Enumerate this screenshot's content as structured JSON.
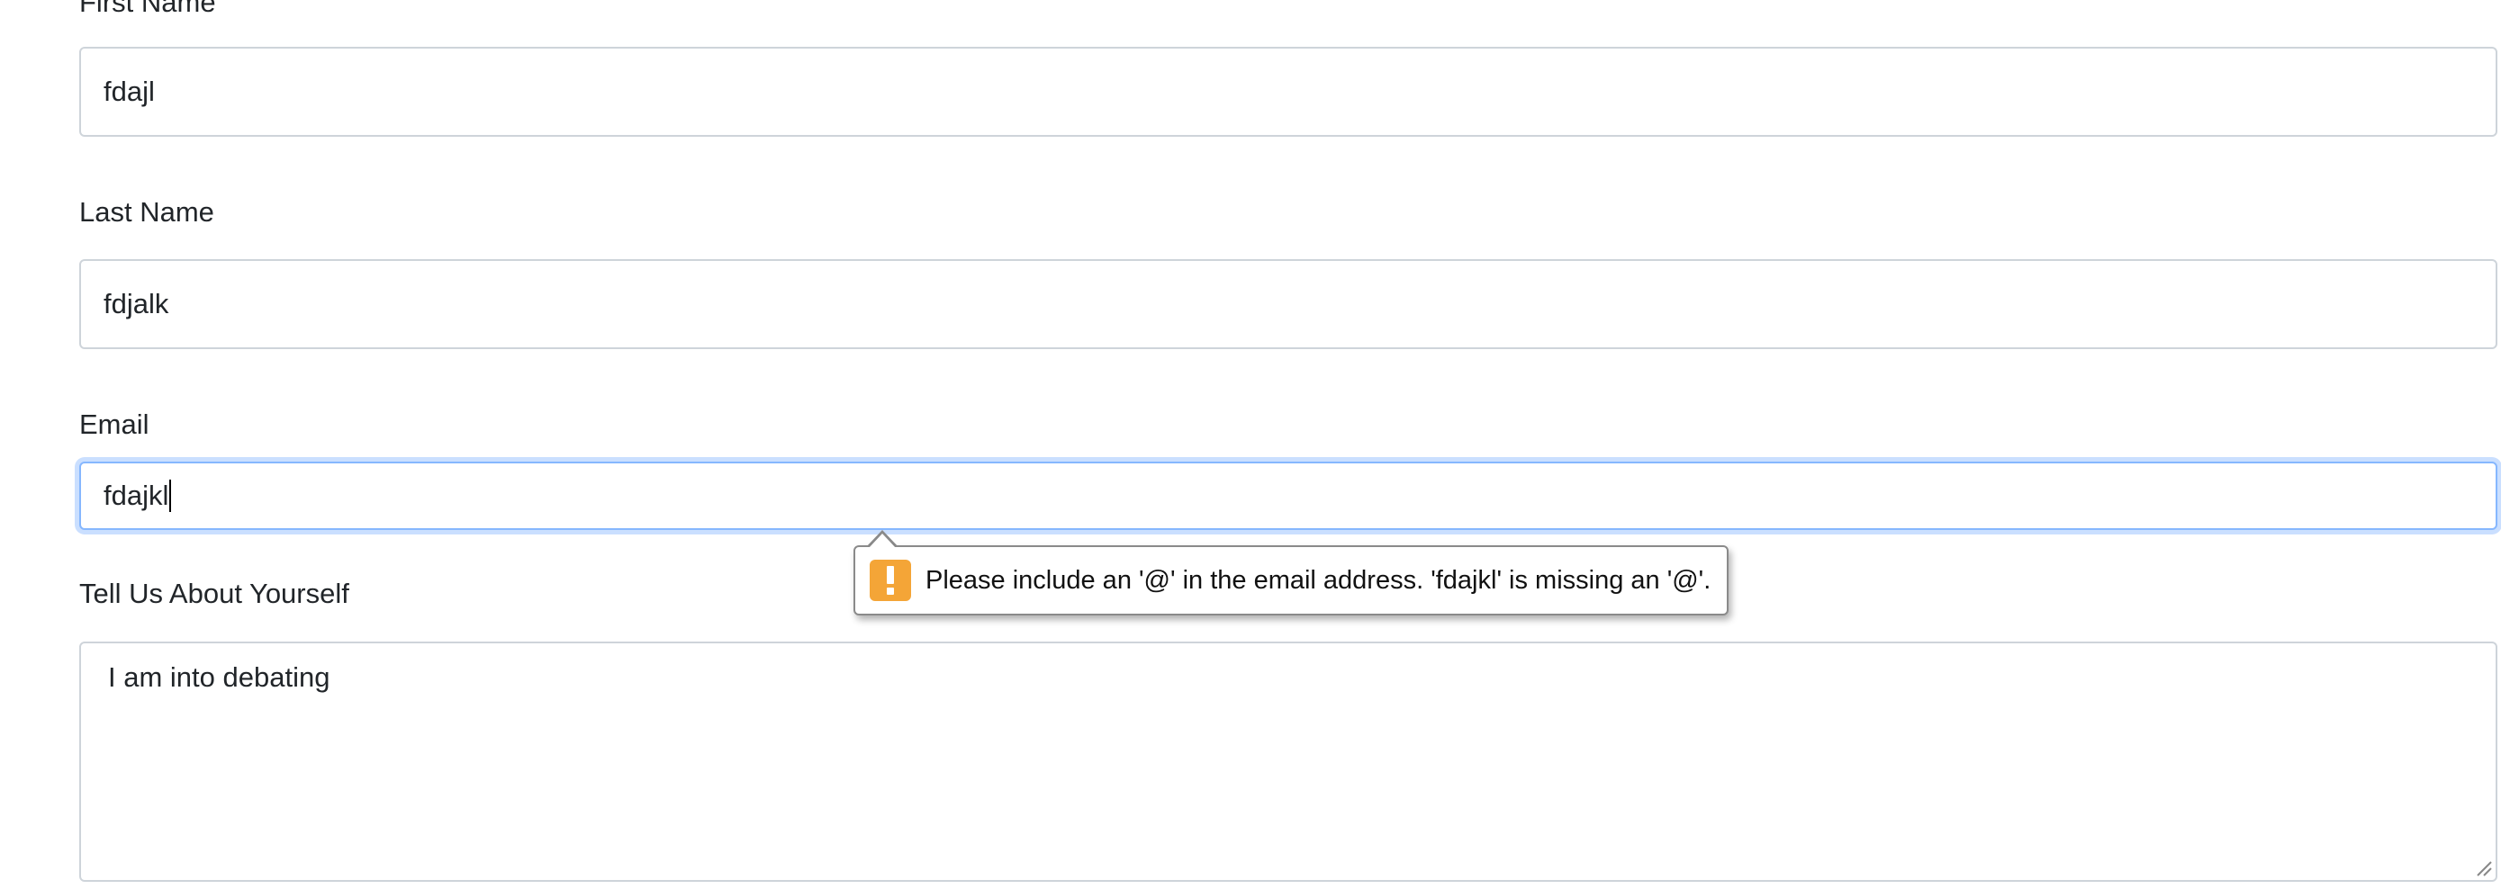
{
  "form": {
    "first_name": {
      "label": "First Name",
      "value": "fdajl"
    },
    "last_name": {
      "label": "Last Name",
      "value": "fdjalk"
    },
    "email": {
      "label": "Email",
      "value": "fdajkl"
    },
    "about": {
      "label": "Tell Us About Yourself",
      "value": "I am into debating"
    }
  },
  "validation_tooltip": {
    "icon": "warning-icon",
    "message": "Please include an '@' in the email address. 'fdajkl' is missing an '@'.",
    "icon_color": "#f4a537"
  },
  "colors": {
    "focus_border": "#86b7fe",
    "input_border": "#ced4da",
    "text": "#212529"
  }
}
